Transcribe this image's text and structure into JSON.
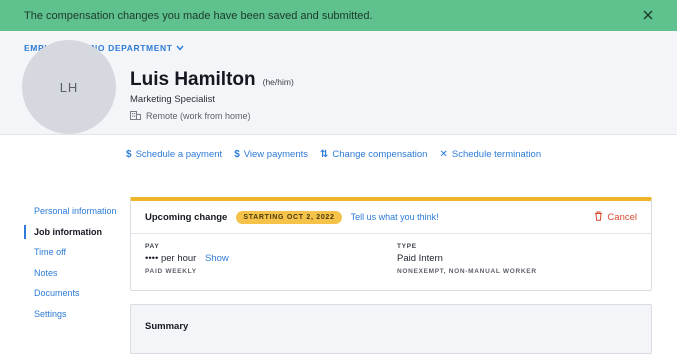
{
  "banner": {
    "message": "The compensation changes you made have been saved and submitted.",
    "bg_color": "#5ec18e",
    "close_icon": "close-icon"
  },
  "header": {
    "breadcrumb": "EMPLOYEES / NO DEPARTMENT",
    "avatar_initials": "LH",
    "name": "Luis Hamilton",
    "pronouns": "(he/him)",
    "job_title": "Marketing Specialist",
    "location": "Remote (work from home)",
    "location_icon": "building-icon"
  },
  "actions": [
    {
      "icon": "dollar-icon",
      "glyph": "$",
      "label": "Schedule a payment"
    },
    {
      "icon": "dollar-icon",
      "glyph": "$",
      "label": "View payments"
    },
    {
      "icon": "swap-icon",
      "glyph": "⇅",
      "label": "Change compensation"
    },
    {
      "icon": "close-icon",
      "glyph": "✕",
      "label": "Schedule termination"
    }
  ],
  "sidenav": {
    "items": [
      {
        "label": "Personal information",
        "active": false
      },
      {
        "label": "Job information",
        "active": true
      },
      {
        "label": "Time off",
        "active": false
      },
      {
        "label": "Notes",
        "active": false
      },
      {
        "label": "Documents",
        "active": false
      },
      {
        "label": "Settings",
        "active": false
      }
    ]
  },
  "upcoming_card": {
    "title": "Upcoming change",
    "badge": "STARTING OCT 2, 2022",
    "feedback_link": "Tell us what you think!",
    "cancel_label": "Cancel",
    "accent_color": "#f0b429",
    "pay": {
      "label": "PAY",
      "value": "•••• per hour",
      "show_link": "Show",
      "sub": "PAID WEEKLY"
    },
    "type": {
      "label": "TYPE",
      "value": "Paid Intern",
      "sub": "NONEXEMPT, NON-MANUAL WORKER"
    }
  },
  "summary_card": {
    "title": "Summary"
  }
}
